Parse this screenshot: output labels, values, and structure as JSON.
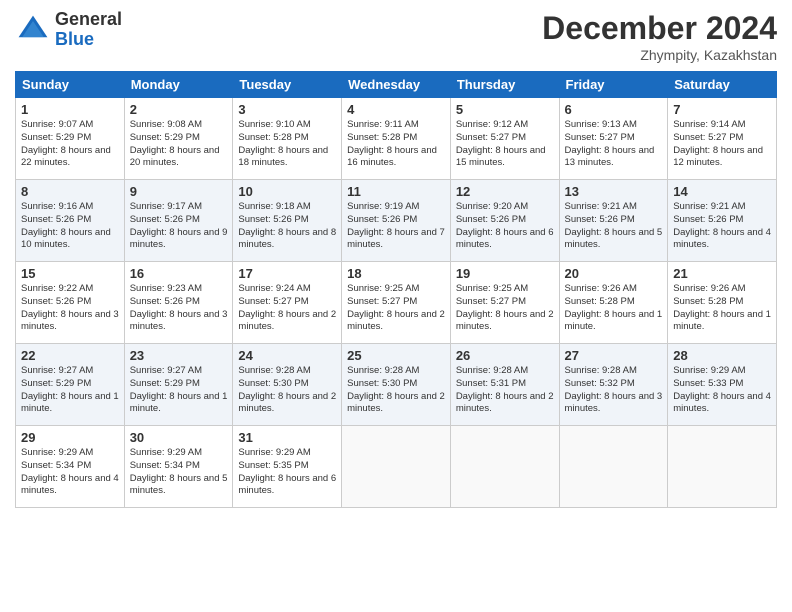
{
  "header": {
    "logo_general": "General",
    "logo_blue": "Blue",
    "month_title": "December 2024",
    "subtitle": "Zhympity, Kazakhstan"
  },
  "days": [
    "Sunday",
    "Monday",
    "Tuesday",
    "Wednesday",
    "Thursday",
    "Friday",
    "Saturday"
  ],
  "weeks": [
    [
      {
        "day": "1",
        "sunrise": "9:07 AM",
        "sunset": "5:29 PM",
        "daylight": "8 hours and 22 minutes."
      },
      {
        "day": "2",
        "sunrise": "9:08 AM",
        "sunset": "5:29 PM",
        "daylight": "8 hours and 20 minutes."
      },
      {
        "day": "3",
        "sunrise": "9:10 AM",
        "sunset": "5:28 PM",
        "daylight": "8 hours and 18 minutes."
      },
      {
        "day": "4",
        "sunrise": "9:11 AM",
        "sunset": "5:28 PM",
        "daylight": "8 hours and 16 minutes."
      },
      {
        "day": "5",
        "sunrise": "9:12 AM",
        "sunset": "5:27 PM",
        "daylight": "8 hours and 15 minutes."
      },
      {
        "day": "6",
        "sunrise": "9:13 AM",
        "sunset": "5:27 PM",
        "daylight": "8 hours and 13 minutes."
      },
      {
        "day": "7",
        "sunrise": "9:14 AM",
        "sunset": "5:27 PM",
        "daylight": "8 hours and 12 minutes."
      }
    ],
    [
      {
        "day": "8",
        "sunrise": "9:16 AM",
        "sunset": "5:26 PM",
        "daylight": "8 hours and 10 minutes."
      },
      {
        "day": "9",
        "sunrise": "9:17 AM",
        "sunset": "5:26 PM",
        "daylight": "8 hours and 9 minutes."
      },
      {
        "day": "10",
        "sunrise": "9:18 AM",
        "sunset": "5:26 PM",
        "daylight": "8 hours and 8 minutes."
      },
      {
        "day": "11",
        "sunrise": "9:19 AM",
        "sunset": "5:26 PM",
        "daylight": "8 hours and 7 minutes."
      },
      {
        "day": "12",
        "sunrise": "9:20 AM",
        "sunset": "5:26 PM",
        "daylight": "8 hours and 6 minutes."
      },
      {
        "day": "13",
        "sunrise": "9:21 AM",
        "sunset": "5:26 PM",
        "daylight": "8 hours and 5 minutes."
      },
      {
        "day": "14",
        "sunrise": "9:21 AM",
        "sunset": "5:26 PM",
        "daylight": "8 hours and 4 minutes."
      }
    ],
    [
      {
        "day": "15",
        "sunrise": "9:22 AM",
        "sunset": "5:26 PM",
        "daylight": "8 hours and 3 minutes."
      },
      {
        "day": "16",
        "sunrise": "9:23 AM",
        "sunset": "5:26 PM",
        "daylight": "8 hours and 3 minutes."
      },
      {
        "day": "17",
        "sunrise": "9:24 AM",
        "sunset": "5:27 PM",
        "daylight": "8 hours and 2 minutes."
      },
      {
        "day": "18",
        "sunrise": "9:25 AM",
        "sunset": "5:27 PM",
        "daylight": "8 hours and 2 minutes."
      },
      {
        "day": "19",
        "sunrise": "9:25 AM",
        "sunset": "5:27 PM",
        "daylight": "8 hours and 2 minutes."
      },
      {
        "day": "20",
        "sunrise": "9:26 AM",
        "sunset": "5:28 PM",
        "daylight": "8 hours and 1 minute."
      },
      {
        "day": "21",
        "sunrise": "9:26 AM",
        "sunset": "5:28 PM",
        "daylight": "8 hours and 1 minute."
      }
    ],
    [
      {
        "day": "22",
        "sunrise": "9:27 AM",
        "sunset": "5:29 PM",
        "daylight": "8 hours and 1 minute."
      },
      {
        "day": "23",
        "sunrise": "9:27 AM",
        "sunset": "5:29 PM",
        "daylight": "8 hours and 1 minute."
      },
      {
        "day": "24",
        "sunrise": "9:28 AM",
        "sunset": "5:30 PM",
        "daylight": "8 hours and 2 minutes."
      },
      {
        "day": "25",
        "sunrise": "9:28 AM",
        "sunset": "5:30 PM",
        "daylight": "8 hours and 2 minutes."
      },
      {
        "day": "26",
        "sunrise": "9:28 AM",
        "sunset": "5:31 PM",
        "daylight": "8 hours and 2 minutes."
      },
      {
        "day": "27",
        "sunrise": "9:28 AM",
        "sunset": "5:32 PM",
        "daylight": "8 hours and 3 minutes."
      },
      {
        "day": "28",
        "sunrise": "9:29 AM",
        "sunset": "5:33 PM",
        "daylight": "8 hours and 4 minutes."
      }
    ],
    [
      {
        "day": "29",
        "sunrise": "9:29 AM",
        "sunset": "5:34 PM",
        "daylight": "8 hours and 4 minutes."
      },
      {
        "day": "30",
        "sunrise": "9:29 AM",
        "sunset": "5:34 PM",
        "daylight": "8 hours and 5 minutes."
      },
      {
        "day": "31",
        "sunrise": "9:29 AM",
        "sunset": "5:35 PM",
        "daylight": "8 hours and 6 minutes."
      },
      null,
      null,
      null,
      null
    ]
  ],
  "labels": {
    "sunrise": "Sunrise:",
    "sunset": "Sunset:",
    "daylight": "Daylight:"
  }
}
